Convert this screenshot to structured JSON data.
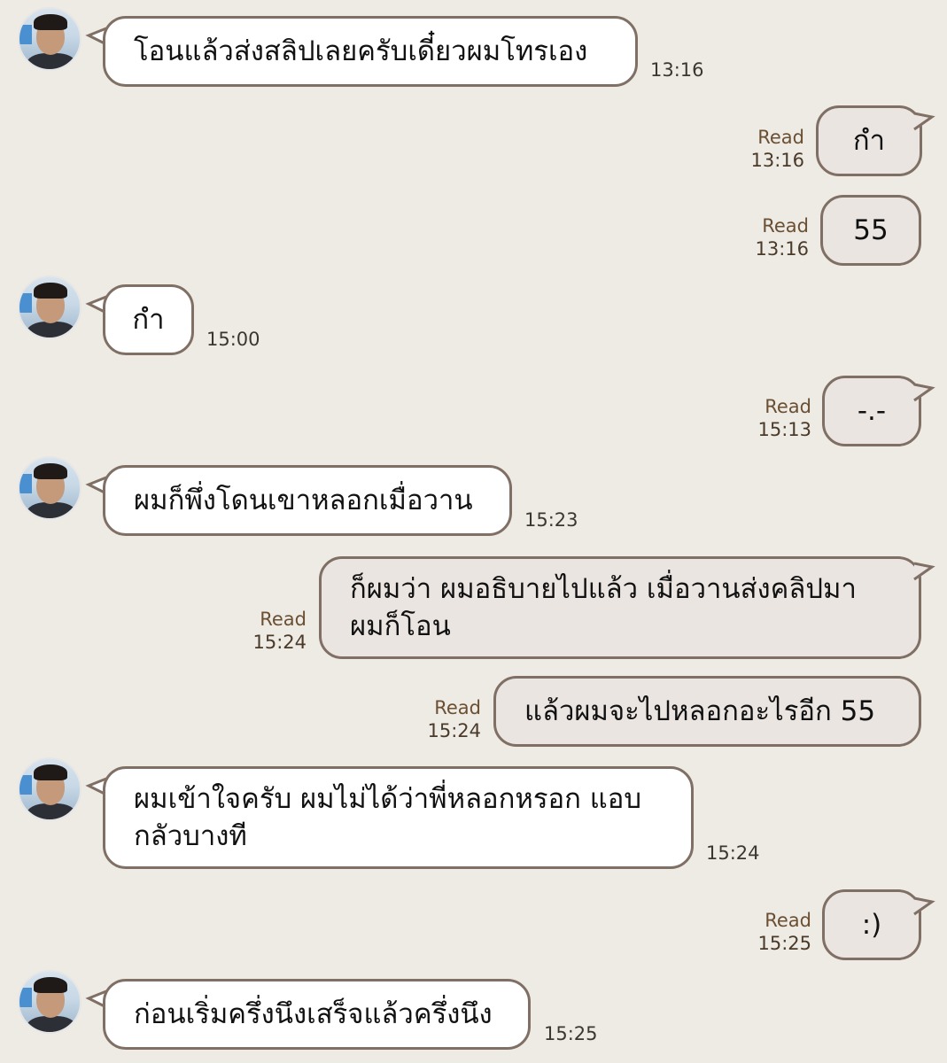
{
  "messages": [
    {
      "side": "in",
      "text": "โอนแล้วส่งสลิปเลยครับเดี๋ยวผมโทรเอง",
      "time": "13:16"
    },
    {
      "side": "out",
      "text": "กำ",
      "read": "Read",
      "time": "13:16"
    },
    {
      "side": "out",
      "text": "55",
      "read": "Read",
      "time": "13:16"
    },
    {
      "side": "in",
      "text": "กำ",
      "time": "15:00"
    },
    {
      "side": "out",
      "text": "-.-",
      "read": "Read",
      "time": "15:13"
    },
    {
      "side": "in",
      "text": "ผมก็พึ่งโดนเขาหลอกเมื่อวาน",
      "time": "15:23"
    },
    {
      "side": "out",
      "text_lines": [
        "ก็ผมว่า ผมอธิบายไปแล้ว เมื่อวานส่งคลิปมา",
        "ผมก็โอน"
      ],
      "read": "Read",
      "time": "15:24"
    },
    {
      "side": "out",
      "text": "แล้วผมจะไปหลอกอะไรอีก 55",
      "read": "Read",
      "time": "15:24"
    },
    {
      "side": "in",
      "text_lines": [
        "ผมเข้าใจครับ ผมไม่ได้ว่าพี่หลอกหรอก แอบ",
        "กลัวบางที"
      ],
      "time": "15:24"
    },
    {
      "side": "out",
      "text": ":)",
      "read": "Read",
      "time": "15:25"
    },
    {
      "side": "in",
      "text": "ก่อนเริ่มครึ่งนึงเสร็จแล้วครึ่งนึง",
      "time": "15:25"
    }
  ],
  "colors": {
    "background": "#eeebe5",
    "incoming_bubble": "#ffffff",
    "outgoing_bubble": "#ebe5e1",
    "bubble_border": "#7f6f64",
    "read_label": "#6a4f33"
  },
  "icons": {
    "avatar": "contact-avatar-photo"
  }
}
